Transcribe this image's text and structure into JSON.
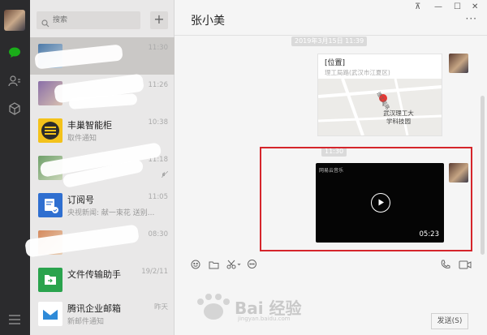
{
  "sidebar": {
    "icons": [
      "chat-icon",
      "contacts-icon",
      "favorites-icon",
      "menu-icon"
    ],
    "accent": "#1aad19"
  },
  "search": {
    "placeholder": "搜索",
    "add_label": "+"
  },
  "conversations": [
    {
      "name": "",
      "msg": "",
      "time": "11:30"
    },
    {
      "name": "",
      "msg": "",
      "time": "11:26"
    },
    {
      "name": "丰巢智能柜",
      "msg": "取件通知",
      "time": "10:38"
    },
    {
      "name": "",
      "msg": "",
      "time": "11:18"
    },
    {
      "name": "订阅号",
      "msg": "央视新闻: 献一束花 送别...",
      "time": "11:05"
    },
    {
      "name": "",
      "msg": "",
      "time": "08:30"
    },
    {
      "name": "文件传输助手",
      "msg": "",
      "time": "19/2/11"
    },
    {
      "name": "腾讯企业邮箱",
      "msg": "新邮件通知",
      "time": "昨天"
    }
  ],
  "chat": {
    "title": "张小美",
    "window_controls": [
      "⊼",
      "—",
      "☐",
      "✕"
    ],
    "more_label": "···",
    "date_stamp": "2019年3月15日 11:39",
    "time_stamp": "11:30",
    "location": {
      "title": "[位置]",
      "address": "理工局路(武汉市江夏区)",
      "map_label": "武汉理工大学科技园",
      "road_label": "理工局路"
    },
    "video": {
      "label": "网易云音乐",
      "duration": "05:23"
    },
    "toolbar": [
      "emoji-icon",
      "folder-icon",
      "scissors-icon",
      "chat-bubble-icon",
      "phone-icon",
      "video-call-icon"
    ],
    "send_label": "发送(S)",
    "highlight_color": "#d5252b"
  },
  "watermark": {
    "text": "Bai 经验",
    "sub": "jingyan.baidu.com"
  }
}
